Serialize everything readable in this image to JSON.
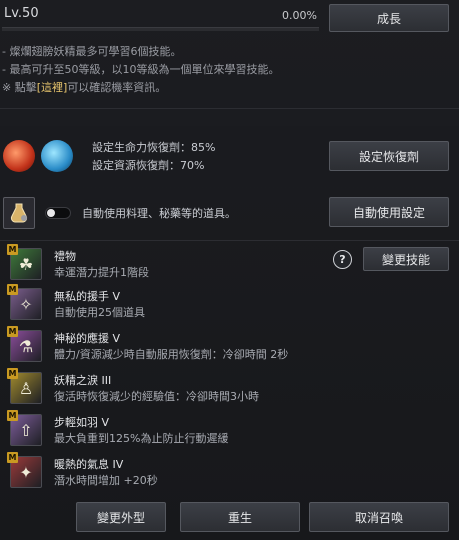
{
  "header": {
    "level": "Lv.50",
    "exp_percent": "0.00%",
    "exp_fraction": 0.0,
    "grow_button": "成長"
  },
  "info_lines": [
    "- 燦爛翅膀妖精最多可學習6個技能。",
    "- 最高可升至50等級，以10等級為一個單位來學習技能。",
    "※ 點擊"
  ],
  "info_link": "[這裡]",
  "info_tail": "可以確認機率資訊。",
  "recovery": {
    "hp_label": "設定生命力恢復劑：85%",
    "mp_label": "設定資源恢復劑：70%",
    "button": "設定恢復劑"
  },
  "auto_use": {
    "label": "自動使用料理、秘藥等的道具。",
    "button": "自動使用設定",
    "toggle_on": false
  },
  "skills_header": {
    "help": "?",
    "change_button": "變更技能"
  },
  "skills": [
    {
      "badge": "M",
      "name": "禮物",
      "desc": "幸運潛力提升1階段",
      "icon": "clover-icon",
      "glyph": "☘",
      "color": "#3e7a3a"
    },
    {
      "badge": "M",
      "name": "無私的援手 V",
      "desc": "自動使用25個道具",
      "icon": "fairy-icon",
      "glyph": "✧",
      "color": "#7a5d8c"
    },
    {
      "badge": "M",
      "name": "神秘的應援 V",
      "desc": "體力/資源減少時自動服用恢復劑：冷卻時間 2秒",
      "icon": "potion-icon",
      "glyph": "⚗",
      "color": "#8a4d9a"
    },
    {
      "badge": "M",
      "name": "妖精之淚 III",
      "desc": "復活時恢復減少的經驗值：冷卻時間3小時",
      "icon": "tear-icon",
      "glyph": "♙",
      "color": "#a08a2e"
    },
    {
      "badge": "M",
      "name": "步輕如羽 V",
      "desc": "最大負重到125%為止防止行動遲緩",
      "icon": "weight-icon",
      "glyph": "⇧",
      "color": "#7d5d9a"
    },
    {
      "badge": "M",
      "name": "暖熱的氣息 IV",
      "desc": "潛水時間增加 +20秒",
      "icon": "breath-icon",
      "glyph": "✦",
      "color": "#9a3a3a"
    }
  ],
  "footer": {
    "change_look": "變更外型",
    "rebirth": "重生",
    "cancel_summon": "取消召喚"
  }
}
